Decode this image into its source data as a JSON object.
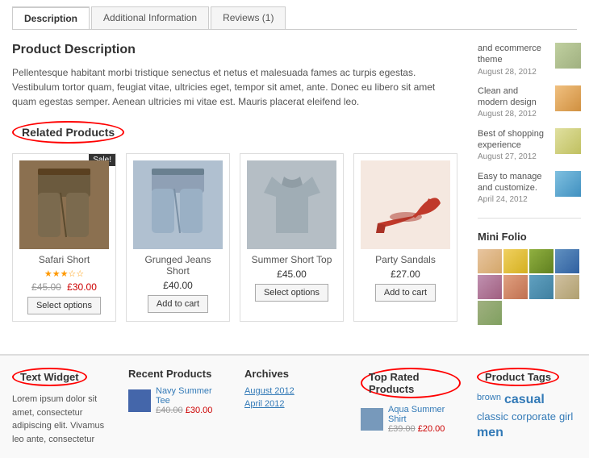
{
  "tabs": [
    {
      "label": "Description",
      "active": true
    },
    {
      "label": "Additional Information",
      "active": false
    },
    {
      "label": "Reviews (1)",
      "active": false
    }
  ],
  "product_description": {
    "title": "Product Description",
    "body": "Pellentesque habitant morbi tristique senectus et netus et malesuada fames ac turpis egestas. Vestibulum tortor quam, feugiat vitae, ultricies eget, tempor sit amet, ante. Donec eu libero sit amet quam egestas semper. Aenean ultricies mi vitae est. Mauris placerat eleifend leo."
  },
  "related_products_title": "Related Products",
  "products": [
    {
      "name": "Safari Short",
      "rating": "★★★☆☆",
      "old_price": "£45.00",
      "new_price": "£30.00",
      "button": "Select options",
      "sale": true,
      "color": "#7B6040"
    },
    {
      "name": "Grunged Jeans Short",
      "price": "£40.00",
      "button": "Add to cart",
      "sale": false,
      "color": "#9AAABF"
    },
    {
      "name": "Summer Short Top",
      "price": "£45.00",
      "button": "Select options",
      "sale": false,
      "color": "#AABAC0"
    },
    {
      "name": "Party Sandals",
      "price": "£27.00",
      "button": "Add to cart",
      "sale": false,
      "color": "#C0392B"
    }
  ],
  "sidebar": {
    "posts": [
      {
        "text": "and ecommerce theme",
        "date": "August 28, 2012"
      },
      {
        "text": "Clean and modern design",
        "date": "August 28, 2012"
      },
      {
        "text": "Best of shopping experience",
        "date": "August 27, 2012"
      },
      {
        "text": "Easy to manage and customize.",
        "date": "April 24, 2012"
      }
    ],
    "mini_folio_label": "Mini Folio"
  },
  "footer": {
    "text_widget": {
      "title": "Text Widget",
      "body": "Lorem ipsum dolor sit amet, consectetur adipiscing elit. Vivamus leo ante, consectetur"
    },
    "recent_products": {
      "title": "Recent Products",
      "items": [
        {
          "name": "Navy Summer Tee",
          "old_price": "£40.00",
          "new_price": "£30.00"
        }
      ]
    },
    "archives": {
      "title": "Archives",
      "items": [
        "August 2012",
        "April 2012"
      ]
    },
    "top_rated": {
      "title": "Top Rated Products",
      "items": [
        {
          "name": "Aqua Summer Shirt",
          "old_price": "£39.00",
          "new_price": "£20.00"
        }
      ]
    },
    "product_tags": {
      "title": "Product Tags",
      "tags": [
        {
          "label": "brown",
          "size": "small"
        },
        {
          "label": "casual",
          "size": "large"
        },
        {
          "label": "classic",
          "size": "medium"
        },
        {
          "label": "corporate",
          "size": "medium"
        },
        {
          "label": "girl",
          "size": "medium"
        },
        {
          "label": "men",
          "size": "large"
        }
      ]
    }
  }
}
